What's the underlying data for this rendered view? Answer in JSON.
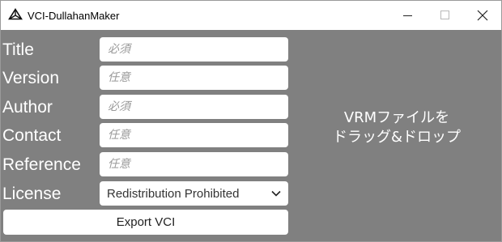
{
  "window": {
    "title": "VCI-DullahanMaker",
    "app_icon": "unity-icon",
    "controls": [
      "minimize-icon",
      "maximize-icon",
      "close-icon"
    ]
  },
  "form": {
    "fields": [
      {
        "label": "Title",
        "value": "",
        "placeholder": "必須"
      },
      {
        "label": "Version",
        "value": "",
        "placeholder": "任意"
      },
      {
        "label": "Author",
        "value": "",
        "placeholder": "必須"
      },
      {
        "label": "Contact",
        "value": "",
        "placeholder": "任意"
      },
      {
        "label": "Reference",
        "value": "",
        "placeholder": "任意"
      }
    ],
    "license": {
      "label": "License",
      "selected": "Redistribution Prohibited"
    },
    "export_label": "Export VCI"
  },
  "drop_zone": {
    "line1": "VRMファイルを",
    "line2": "ドラッグ&ドロップ"
  },
  "colors": {
    "background": "#808080",
    "text": "#ffffff",
    "field": "#ffffff",
    "placeholder": "#9a9a9a"
  }
}
